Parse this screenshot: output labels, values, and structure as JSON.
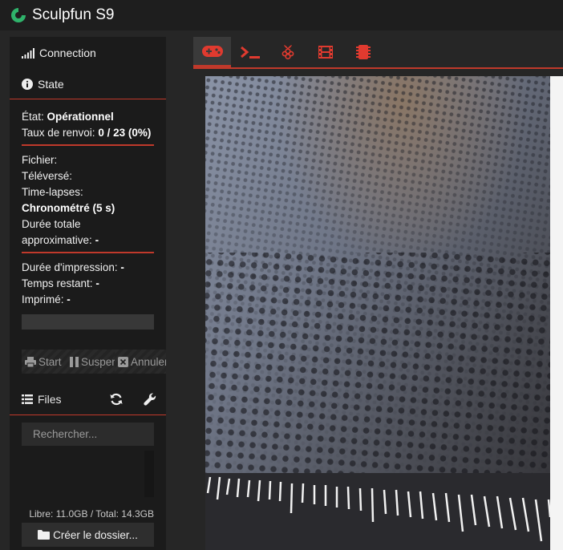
{
  "app": {
    "title": "Sculpfun S9"
  },
  "sidebar": {
    "connection_label": "Connection",
    "state_label": "State",
    "state": {
      "etat_label": "État:",
      "etat_value": "Opérationnel",
      "taux_label": "Taux de renvoi:",
      "taux_value": "0 / 23 (0%)",
      "fichier_label": "Fichier:",
      "televerse_label": "Téléversé:",
      "timelapse_label": "Time-lapses:",
      "timelapse_value": "Chronométré (5 s)",
      "duree_totale_label": "Durée totale approximative:",
      "duree_totale_value": "-",
      "duree_impression_label": "Durée d'impression:",
      "duree_impression_value": "-",
      "temps_restant_label": "Temps restant:",
      "temps_restant_value": "-",
      "imprime_label": "Imprimé:",
      "imprime_value": "-",
      "progress": 0
    },
    "buttons": {
      "start": "Start",
      "suspend": "Suspendre",
      "cancel": "Annuler"
    },
    "files": {
      "label": "Files",
      "search_placeholder": "Rechercher...",
      "disk": "Libre: 11.0GB / Total: 14.3GB",
      "create_folder": "Créer le dossier..."
    }
  },
  "main": {
    "tabs": [
      {
        "icon": "gamepad-icon",
        "active": true
      },
      {
        "icon": "terminal-icon",
        "active": false
      },
      {
        "icon": "raspberry-icon",
        "active": false
      },
      {
        "icon": "film-icon",
        "active": false
      },
      {
        "icon": "chip-icon",
        "active": false
      }
    ]
  },
  "colors": {
    "accent": "#c0392b",
    "logo": "#2fb36b"
  }
}
